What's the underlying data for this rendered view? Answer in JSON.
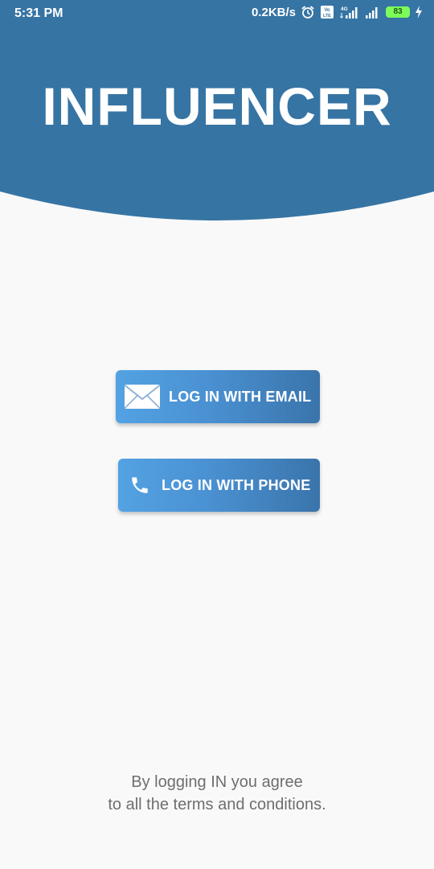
{
  "status_bar": {
    "time": "5:31 PM",
    "network_speed": "0.2KB/s",
    "network_type": "4G",
    "volte_label": "Vo LTE",
    "battery_level": "83",
    "icons": [
      "alarm-icon",
      "volte-icon",
      "signal-icon",
      "signal-icon",
      "battery-icon",
      "charging-icon"
    ]
  },
  "header": {
    "title": "INFLUENCER",
    "background_color": "#3674a3"
  },
  "buttons": {
    "email": {
      "label": "LOG IN WITH EMAIL",
      "icon": "envelope-icon"
    },
    "phone": {
      "label": "LOG IN WITH PHONE",
      "icon": "phone-icon"
    }
  },
  "footer": {
    "line1": "By logging IN you agree",
    "line2": "to all the terms and conditions."
  },
  "colors": {
    "primary": "#3674a3",
    "button_gradient_start": "#53a2e3",
    "button_gradient_end": "#3a74ab",
    "background": "#f9f9f9",
    "footer_text": "#6e6e6e"
  }
}
